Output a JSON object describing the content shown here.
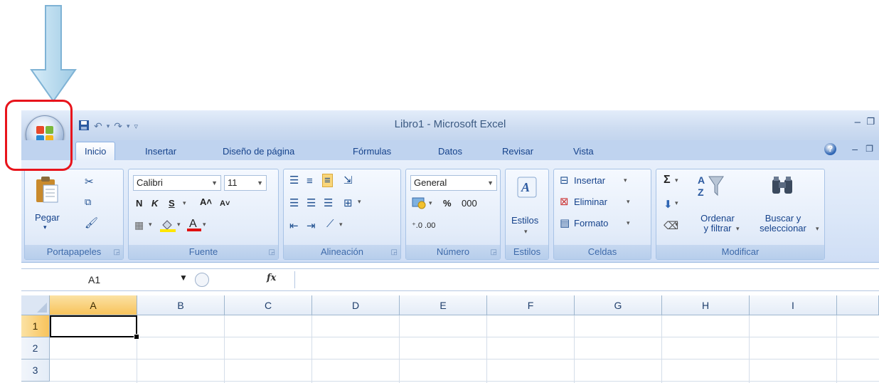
{
  "window": {
    "title": "Libro1 - Microsoft Excel",
    "minimize_glyph": "–",
    "restore_glyph": "❐"
  },
  "quick_access": {
    "save_icon": "save-icon",
    "undo_icon": "undo-icon",
    "redo_icon": "redo-icon",
    "customize_icon": "customize-qat-icon"
  },
  "tabs": [
    {
      "label": "Inicio",
      "active": true
    },
    {
      "label": "Insertar"
    },
    {
      "label": "Diseño de página"
    },
    {
      "label": "Fórmulas"
    },
    {
      "label": "Datos"
    },
    {
      "label": "Revisar"
    },
    {
      "label": "Vista"
    }
  ],
  "ribbon": {
    "clipboard": {
      "label": "Portapapeles",
      "paste": "Pegar"
    },
    "font": {
      "label": "Fuente",
      "font_name": "Calibri",
      "font_size": "11",
      "bold": "N",
      "italic": "K",
      "underline": "S",
      "grow": "A˄",
      "shrink": "A˅"
    },
    "alignment": {
      "label": "Alineación"
    },
    "number": {
      "label": "Número",
      "format": "General",
      "percent": "%",
      "thousands": "000"
    },
    "styles": {
      "label": "Estilos"
    },
    "cells": {
      "label": "Celdas",
      "insert": "Insertar",
      "delete": "Eliminar",
      "format": "Formato"
    },
    "editing": {
      "label": "Modificar",
      "sort_line1": "Ordenar",
      "sort_line2": "y filtrar",
      "find_line1": "Buscar y",
      "find_line2": "seleccionar"
    }
  },
  "formula_bar": {
    "name_box": "A1",
    "fx": "fx",
    "value": ""
  },
  "grid": {
    "columns": [
      "A",
      "B",
      "C",
      "D",
      "E",
      "F",
      "G",
      "H",
      "I"
    ],
    "rows": [
      "1",
      "2",
      "3"
    ],
    "active_cell": "A1"
  },
  "colors": {
    "annotation_red": "#e8141c",
    "arrow_fill": "#b9dcef",
    "arrow_stroke": "#7fb3d5",
    "ribbon_text": "#15428b",
    "selected_header": "#f8c35b"
  }
}
